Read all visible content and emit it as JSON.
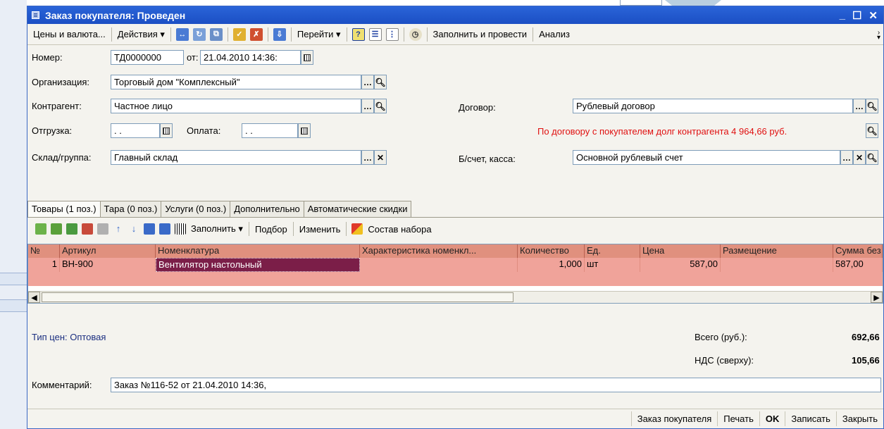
{
  "window": {
    "title": "Заказ покупателя: Проведен"
  },
  "toolbar": {
    "prices": "Цены и валюта...",
    "actions": "Действия ▾",
    "goto": "Перейти ▾",
    "help": "?",
    "fill_post": "Заполнить и провести",
    "analysis": "Анализ"
  },
  "form": {
    "number_label": "Номер:",
    "number_value": "ТД0000000",
    "from_label": "от:",
    "date_value": "21.04.2010 14:36:",
    "org_label": "Организация:",
    "org_value": "Торговый дом \"Комплексный\"",
    "counterparty_label": "Контрагент:",
    "counterparty_value": "Частное лицо",
    "contract_label": "Договор:",
    "contract_value": "Рублевый договор",
    "shipment_label": "Отгрузка:",
    "shipment_value": " .  .",
    "payment_label": "Оплата:",
    "payment_value": " .  .",
    "debt_note": "По договору с покупателем долг контрагента 4 964,66 руб.",
    "warehouse_label": "Склад/группа:",
    "warehouse_value": "Главный склад",
    "account_label": "Б/счет, касса:",
    "account_value": "Основной рублевый счет"
  },
  "tabs": [
    "Товары (1 поз.)",
    "Тара (0 поз.)",
    "Услуги (0 поз.)",
    "Дополнительно",
    "Автоматические скидки"
  ],
  "panel_toolbar": {
    "fill": "Заполнить ▾",
    "pick": "Подбор",
    "change": "Изменить",
    "kit": "Состав набора"
  },
  "table": {
    "columns": [
      "№",
      "Артикул",
      "Номенклатура",
      "Характеристика номенкл...",
      "Количество",
      "Ед.",
      "Цена",
      "Размещение",
      "Сумма без"
    ],
    "rows": [
      [
        "1",
        "ВН-900",
        "Вентилятор настольный",
        "",
        "1,000",
        "шт",
        "587,00",
        "",
        "587,00"
      ]
    ]
  },
  "summary": {
    "price_type": "Тип цен: Оптовая",
    "total_label": "Всего (руб.):",
    "total_value": "692,66",
    "vat_label": "НДС (сверху):",
    "vat_value": "105,66"
  },
  "comment": {
    "label": "Комментарий:",
    "value": "Заказ №116-52 от 21.04.2010 14:36,"
  },
  "bottom_buttons": {
    "order": "Заказ покупателя",
    "print": "Печать",
    "ok": "OK",
    "save": "Записать",
    "close": "Закрыть"
  },
  "colors": {
    "title_bar": "#1b4fc4",
    "grid_header": "#e0907e",
    "grid_row": "#f0a39a",
    "selected_cell": "#7b1e48",
    "debt_text": "#e01010"
  }
}
